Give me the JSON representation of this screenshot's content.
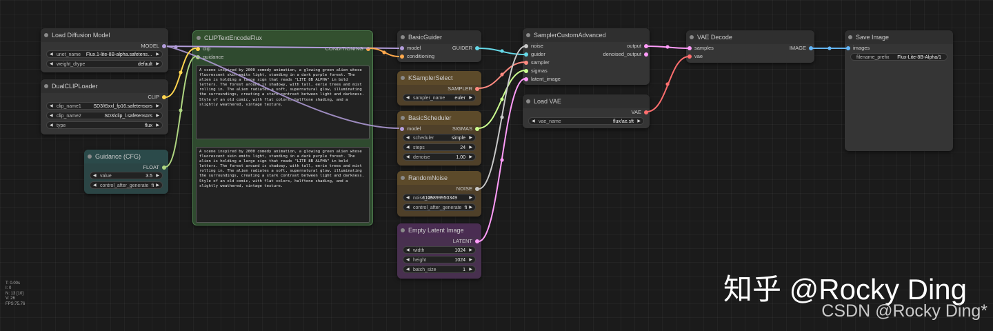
{
  "nodes": {
    "load_diffusion_model": {
      "title": "Load Diffusion Model",
      "output": "MODEL",
      "widgets": [
        {
          "label": "unet_name",
          "value": "Flux.1-lite-8B-alpha.safetens…"
        },
        {
          "label": "weight_dtype",
          "value": "default"
        }
      ]
    },
    "dual_clip_loader": {
      "title": "DualCLIPLoader",
      "output": "CLIP",
      "widgets": [
        {
          "label": "clip_name1",
          "value": "SD3/t5xxl_fp16.safetensors"
        },
        {
          "label": "clip_name2",
          "value": "SD3/clip_l.safetensors"
        },
        {
          "label": "type",
          "value": "flux"
        }
      ]
    },
    "guidance_cfg": {
      "title": "Guidance (CFG)",
      "output": "FLOAT",
      "widgets": [
        {
          "label": "value",
          "value": "3.5"
        },
        {
          "label": "control_after_generate",
          "value": "fi"
        }
      ]
    },
    "clip_text_encode_flux": {
      "title": "CLIPTextEncodeFlux",
      "inputs": [
        "clip",
        "guidance"
      ],
      "output": "CONDITIONING",
      "prompt1": "A scene inspired by 2000 comedy animation, a glowing green alien whose fluorescent skin emits light, standing in a dark purple forest. The alien is holding a large sign that reads \"LITE 8B ALPHA\" in bold letters. The forest around is shadowy, with tall, eerie trees and mist rolling in. The alien radiates a soft, supernatural glow, illuminating the surroundings, creating a stark contrast between light and darkness. Style of an old comic, with flat colors, halftone shading, and a slightly weathered, vintage texture.",
      "prompt2": "A scene inspired by 2000 comedy animation, a glowing green alien whose fluorescent skin emits light, standing in a dark purple forest. The alien is holding a large sign that reads \"LITE 8B ALPHA\" in bold letters. The forest around is shadowy, with tall, eerie trees and mist rolling in. The alien radiates a soft, supernatural glow, illuminating the surroundings, creating a stark contrast between light and darkness. Style of an old comic, with flat colors, halftone shading, and a slightly weathered, vintage texture."
    },
    "basic_guider": {
      "title": "BasicGuider",
      "inputs": [
        "model",
        "conditioning"
      ],
      "output": "GUIDER"
    },
    "ksampler_select": {
      "title": "KSamplerSelect",
      "output": "SAMPLER",
      "widgets": [
        {
          "label": "sampler_name",
          "value": "euler"
        }
      ]
    },
    "basic_scheduler": {
      "title": "BasicScheduler",
      "inputs": [
        "model"
      ],
      "output": "SIGMAS",
      "widgets": [
        {
          "label": "scheduler",
          "value": "simple"
        },
        {
          "label": "steps",
          "value": "24"
        },
        {
          "label": "denoise",
          "value": "1.00"
        }
      ]
    },
    "random_noise": {
      "title": "RandomNoise",
      "output": "NOISE",
      "widgets": [
        {
          "label": "noise_se",
          "value": "1125899950349"
        },
        {
          "label": "control_after_generate",
          "value": "fi"
        }
      ]
    },
    "empty_latent": {
      "title": "Empty Latent Image",
      "output": "LATENT",
      "widgets": [
        {
          "label": "width",
          "value": "1024"
        },
        {
          "label": "height",
          "value": "1024"
        },
        {
          "label": "batch_size",
          "value": "1"
        }
      ]
    },
    "sampler_custom_advanced": {
      "title": "SamplerCustomAdvanced",
      "inputs": [
        "noise",
        "guider",
        "sampler",
        "sigmas",
        "latent_image"
      ],
      "outputs": [
        "output",
        "denoised_output"
      ]
    },
    "load_vae": {
      "title": "Load VAE",
      "output": "VAE",
      "widgets": [
        {
          "label": "vae_name",
          "value": "flux/ae.sft"
        }
      ]
    },
    "vae_decode": {
      "title": "VAE Decode",
      "inputs": [
        "samples",
        "vae"
      ],
      "output": "IMAGE"
    },
    "save_image": {
      "title": "Save Image",
      "inputs": [
        "images"
      ],
      "widgets": [
        {
          "label": "filename_prefix",
          "value": "Flux-Lite-8B-Alpha/1"
        }
      ]
    }
  },
  "stats": [
    "T: 0.00s",
    "I: 0",
    "N: 13 [10]",
    "V: 26",
    "FPS:75.76"
  ],
  "watermark": {
    "line1": "知乎 @Rocky Ding",
    "line2": "CSDN @Rocky Ding*"
  },
  "colors": {
    "model": "#b39ddb",
    "clip": "#ffd54f",
    "float": "#aed581",
    "conditioning": "#ffa94d",
    "guider": "#66d9e8",
    "sampler": "#ff8a80",
    "sigmas": "#ccff90",
    "noise": "#c8c8c8",
    "latent": "#ff9cf9",
    "vae": "#ff6e6e",
    "image": "#64b5f6",
    "node_default": "#353535",
    "node_green": "#2f4a2f",
    "node_teal": "#2b4a4a",
    "node_brown": "#5c4a2a",
    "node_purple": "#4a2d52"
  }
}
